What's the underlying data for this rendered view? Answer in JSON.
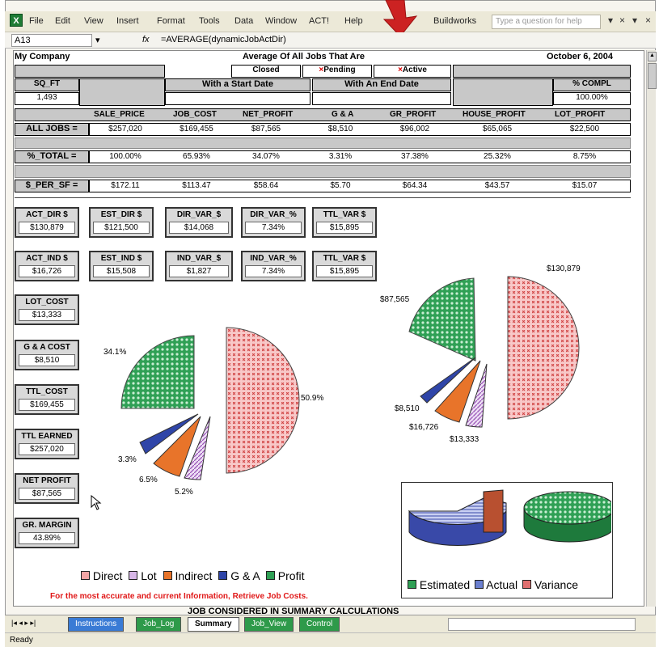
{
  "menu": {
    "items": [
      "File",
      "Edit",
      "View",
      "Insert",
      "Format",
      "Tools",
      "Data",
      "Window",
      "ACT!",
      "Help",
      "Buildworks"
    ],
    "help_placeholder": "Type a question for help",
    "controls": [
      "▾",
      "×",
      "▾",
      "×"
    ]
  },
  "formula_bar": {
    "cell": "A13",
    "fx": "fx",
    "formula": "=AVERAGE(dynamicJobActDir)"
  },
  "report": {
    "company": "My Company",
    "title": "Average Of All Jobs That Are",
    "date": "October 6, 2004",
    "filters": [
      "Closed",
      "Pending",
      "Active"
    ],
    "filter_marks": [
      "",
      "×",
      "×"
    ],
    "start_date_label": "With a Start Date",
    "end_date_label": "With An End Date",
    "sq_ft_label": "SQ_FT",
    "sq_ft_value": "1,493",
    "pct_compl_label": "% COMPL",
    "pct_compl_value": "100.00%",
    "columns": [
      "SALE_PRICE",
      "JOB_COST",
      "NET_PROFIT",
      "G & A",
      "GR_PROFIT",
      "HOUSE_PROFIT",
      "LOT_PROFIT"
    ],
    "rows": [
      {
        "label": "ALL JOBS =",
        "values": [
          "$257,020",
          "$169,455",
          "$87,565",
          "$8,510",
          "$96,002",
          "$65,065",
          "$22,500"
        ]
      },
      {
        "label": "%_TOTAL =",
        "values": [
          "100.00%",
          "65.93%",
          "34.07%",
          "3.31%",
          "37.38%",
          "25.32%",
          "8.75%"
        ]
      },
      {
        "label": "$_PER_SF =",
        "values": [
          "$172.11",
          "$113.47",
          "$58.64",
          "$5.70",
          "$64.34",
          "$43.57",
          "$15.07"
        ]
      }
    ]
  },
  "kpis_row1": [
    {
      "label": "ACT_DIR $",
      "value": "$130,879"
    },
    {
      "label": "EST_DIR $",
      "value": "$121,500"
    },
    {
      "label": "DIR_VAR_$",
      "value": "$14,068"
    },
    {
      "label": "DIR_VAR_%",
      "value": "7.34%"
    },
    {
      "label": "TTL_VAR $",
      "value": "$15,895"
    }
  ],
  "kpis_row2": [
    {
      "label": "ACT_IND $",
      "value": "$16,726"
    },
    {
      "label": "EST_IND $",
      "value": "$15,508"
    },
    {
      "label": "IND_VAR_$",
      "value": "$1,827"
    },
    {
      "label": "IND_VAR_%",
      "value": "7.34%"
    },
    {
      "label": "TTL_VAR $",
      "value": "$15,895"
    }
  ],
  "kpis_col": [
    {
      "label": "LOT_COST",
      "value": "$13,333"
    },
    {
      "label": "G & A COST",
      "value": "$8,510"
    },
    {
      "label": "TTL_COST",
      "value": "$169,455"
    },
    {
      "label": "TTL EARNED",
      "value": "$257,020"
    },
    {
      "label": "NET PROFIT",
      "value": "$87,565"
    },
    {
      "label": "GR. MARGIN",
      "value": "43.89%"
    }
  ],
  "pie_left": {
    "labels": [
      "50.9%",
      "34.1%",
      "3.3%",
      "6.5%",
      "5.2%"
    ]
  },
  "pie_right": {
    "labels": [
      "$130,879",
      "$87,565",
      "$8,510",
      "$16,726",
      "$13,333"
    ]
  },
  "legend_left": [
    "Direct",
    "Lot",
    "Indirect",
    "G & A",
    "Profit"
  ],
  "legend_right": [
    "Estimated",
    "Actual",
    "Variance"
  ],
  "colors": {
    "direct": "#f4a5a5",
    "lot": "#d8b7e8",
    "indirect": "#e8742a",
    "ga": "#2f45a8",
    "profit": "#2fa055",
    "estimated": "#2fa055",
    "actual": "#6b7fcf",
    "variance": "#e07070"
  },
  "warning_text": "For the most accurate and current Information, Retrieve Job Costs.",
  "bottom_heading": "JOB CONSIDERED IN SUMMARY CALCULATIONS",
  "tabs": [
    "Instructions",
    "Job_Log",
    "Summary",
    "Job_View",
    "Control"
  ],
  "status": "Ready"
}
